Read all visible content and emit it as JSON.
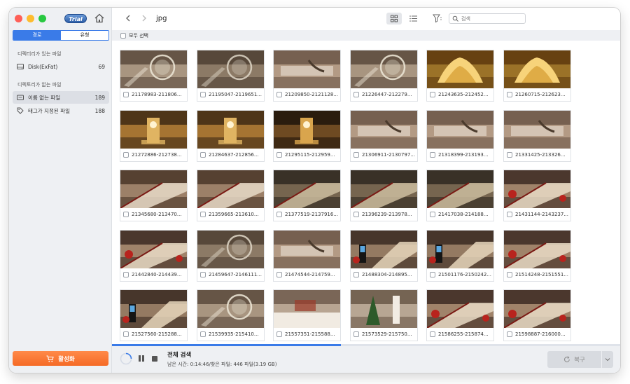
{
  "app": {
    "trial_badge": "Trial"
  },
  "sidebar": {
    "tabs": [
      {
        "label": "경로",
        "active": true
      },
      {
        "label": "유형",
        "active": false
      }
    ],
    "sections": [
      {
        "title": "디렉터리가 있는 파일",
        "items": [
          {
            "label": "Disk(ExFat)",
            "count": "69",
            "icon": "disk-icon",
            "selected": false
          }
        ]
      },
      {
        "title": "디렉토리가 없는 파일",
        "items": [
          {
            "label": "이름 없는 파일",
            "count": "189",
            "icon": "folder-icon",
            "selected": true
          },
          {
            "label": "태그가 지정된 파일",
            "count": "188",
            "icon": "tag-icon",
            "selected": false
          }
        ]
      }
    ],
    "activate_label": "활성화"
  },
  "toolbar": {
    "folder": "jpg",
    "search_placeholder": "검색"
  },
  "select_all_label": "모두 선택",
  "files": [
    {
      "name": "21178983-211806...",
      "scene": "chandelier"
    },
    {
      "name": "21195047-2119651...",
      "scene": "stair-orb"
    },
    {
      "name": "21209850-2121128...",
      "scene": "lobby"
    },
    {
      "name": "21226447-212279...",
      "scene": "chandelier"
    },
    {
      "name": "21243635-212452...",
      "scene": "gold"
    },
    {
      "name": "21260715-212623...",
      "scene": "gold"
    },
    {
      "name": "21272886-212738...",
      "scene": "clock"
    },
    {
      "name": "21284637-212856...",
      "scene": "clock"
    },
    {
      "name": "21295115-212959...",
      "scene": "clock-dark"
    },
    {
      "name": "21306911-2130797...",
      "scene": "lobby"
    },
    {
      "name": "21318399-213193...",
      "scene": "lobby"
    },
    {
      "name": "21331425-213326...",
      "scene": "lobby"
    },
    {
      "name": "21345680-213470...",
      "scene": "staircase"
    },
    {
      "name": "21359665-213610...",
      "scene": "staircase"
    },
    {
      "name": "21377519-2137916...",
      "scene": "stair-dark"
    },
    {
      "name": "21396239-213978...",
      "scene": "stair-dark"
    },
    {
      "name": "21417038-214188...",
      "scene": "stair-dark"
    },
    {
      "name": "21431144-2143237...",
      "scene": "stair-red"
    },
    {
      "name": "21442840-214439...",
      "scene": "stair-red"
    },
    {
      "name": "21459647-2146111...",
      "scene": "stair-orb"
    },
    {
      "name": "21474544-214759...",
      "scene": "lobby"
    },
    {
      "name": "21488304-214895...",
      "scene": "kiosk"
    },
    {
      "name": "21501176-2150242...",
      "scene": "kiosk"
    },
    {
      "name": "21514248-2151551...",
      "scene": "stair-red"
    },
    {
      "name": "21527560-215288...",
      "scene": "kiosk"
    },
    {
      "name": "21539935-215410...",
      "scene": "chandelier"
    },
    {
      "name": "21557351-215588...",
      "scene": "lobby-floor"
    },
    {
      "name": "21573529-215750...",
      "scene": "tree"
    },
    {
      "name": "21586255-215874...",
      "scene": "stair-red"
    },
    {
      "name": "21598887-216000...",
      "scene": "stair-red"
    }
  ],
  "scan": {
    "title": "전체 검색",
    "status": "남은 시간: 0:14:46/찾은 파일: 446 파일(3.19 GB)",
    "progress": 0.45
  },
  "recover_label": "복구",
  "colors": {
    "accent": "#3a7be8",
    "activate": "#f56a25"
  }
}
